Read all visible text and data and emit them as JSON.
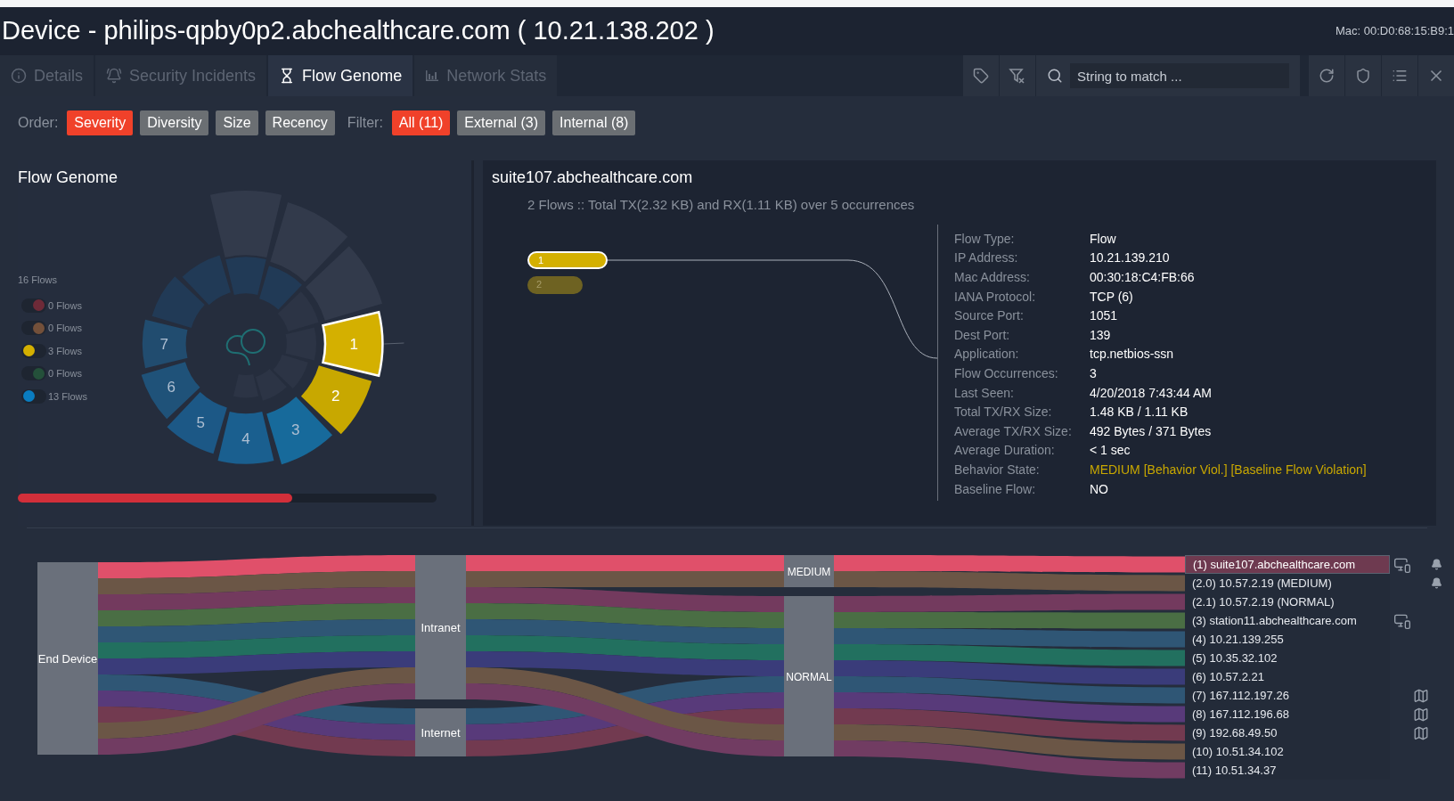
{
  "window": {
    "title": "Device - philips-qpby0p2.abchealthcare.com ( 10.21.138.202 )",
    "mac": "Mac: 00:D0:68:15:B9:1"
  },
  "tabs": [
    {
      "label": "Details",
      "selected": false
    },
    {
      "label": "Security Incidents",
      "selected": false
    },
    {
      "label": "Flow Genome",
      "selected": true
    },
    {
      "label": "Network Stats",
      "selected": false
    }
  ],
  "search": {
    "placeholder": "String to match ..."
  },
  "order": {
    "label": "Order:",
    "options": [
      {
        "label": "Severity",
        "selected": true
      },
      {
        "label": "Diversity",
        "selected": false
      },
      {
        "label": "Size",
        "selected": false
      },
      {
        "label": "Recency",
        "selected": false
      }
    ]
  },
  "filter": {
    "label": "Filter:",
    "options": [
      {
        "label": "All (11)",
        "selected": true
      },
      {
        "label": "External (3)",
        "selected": false
      },
      {
        "label": "Internal (8)",
        "selected": false
      }
    ]
  },
  "genome": {
    "title": "Flow Genome",
    "total": "16 Flows",
    "legend": [
      {
        "label": "0 Flows",
        "color": "#6e2a38",
        "muted": true
      },
      {
        "label": "0 Flows",
        "color": "#73503a",
        "muted": true
      },
      {
        "label": "3 Flows",
        "color": "#d4b000",
        "muted": false
      },
      {
        "label": "0 Flows",
        "color": "#24503a",
        "muted": true
      },
      {
        "label": "13 Flows",
        "color": "#0a7cc0",
        "muted": false
      }
    ],
    "segments": [
      {
        "label": "1",
        "color": "#d4b000",
        "selected": true
      },
      {
        "label": "2",
        "color": "#c8a800",
        "selected": false
      },
      {
        "label": "3",
        "color": "#176a9b",
        "selected": false
      },
      {
        "label": "4",
        "color": "#1a5f8f",
        "selected": false
      },
      {
        "label": "5",
        "color": "#1c5886",
        "selected": false
      },
      {
        "label": "6",
        "color": "#1f5279",
        "selected": false
      },
      {
        "label": "7",
        "color": "#214c6f",
        "selected": false
      }
    ],
    "progress": {
      "level": 0.655
    }
  },
  "details": {
    "title": "suite107.abchealthcare.com",
    "summary": "2 Flows :: Total TX(2.32 KB) and RX(1.11 KB) over 5 occurrences",
    "flows": [
      {
        "label": "1",
        "selected": true
      },
      {
        "label": "2",
        "selected": false
      }
    ],
    "fields": [
      {
        "label": "Flow Type:",
        "value": "Flow",
        "alert": false
      },
      {
        "label": "IP Address:",
        "value": "10.21.139.210",
        "alert": false
      },
      {
        "label": "Mac Address:",
        "value": "00:30:18:C4:FB:66",
        "alert": false
      },
      {
        "label": "IANA Protocol:",
        "value": "TCP (6)",
        "alert": false
      },
      {
        "label": "Source Port:",
        "value": "1051",
        "alert": false
      },
      {
        "label": "Dest Port:",
        "value": "139",
        "alert": false
      },
      {
        "label": "Application:",
        "value": "tcp.netbios-ssn",
        "alert": false
      },
      {
        "label": "Flow Occurrences:",
        "value": "3",
        "alert": false
      },
      {
        "label": "Last Seen:",
        "value": "4/20/2018 7:43:44 AM",
        "alert": false
      },
      {
        "label": "Total TX/RX Size:",
        "value": "1.48 KB / 1.11 KB",
        "alert": false
      },
      {
        "label": "Average TX/RX Size:",
        "value": "492 Bytes / 371 Bytes",
        "alert": false
      },
      {
        "label": "Average Duration:",
        "value": "< 1 sec",
        "alert": false
      },
      {
        "label": "Behavior State:",
        "value": "MEDIUM [Behavior Viol.] [Baseline Flow Violation]",
        "alert": true
      },
      {
        "label": "Baseline Flow:",
        "value": "NO",
        "alert": false
      }
    ]
  },
  "sankey": {
    "source": "End Device",
    "networks": [
      "Intranet",
      "Internet"
    ],
    "states": [
      "MEDIUM",
      "NORMAL"
    ],
    "destinations": [
      {
        "label": "(1) suite107.abchealthcare.com",
        "color": "#e0506a",
        "selected": true,
        "device": true,
        "incident": true,
        "geolocated": false
      },
      {
        "label": "(2.0) 10.57.2.19 (MEDIUM)",
        "color": "#6b5646",
        "selected": false,
        "device": false,
        "incident": true,
        "geolocated": false
      },
      {
        "label": "(2.1) 10.57.2.19 (NORMAL)",
        "color": "#733a5e",
        "selected": false,
        "device": false,
        "incident": false,
        "geolocated": false
      },
      {
        "label": "(3) station11.abchealthcare.com",
        "color": "#4a6e44",
        "selected": false,
        "device": true,
        "incident": false,
        "geolocated": false
      },
      {
        "label": "(4) 10.21.139.255",
        "color": "#2f5675",
        "selected": false,
        "device": false,
        "incident": false,
        "geolocated": false
      },
      {
        "label": "(5) 10.35.32.102",
        "color": "#22705f",
        "selected": false,
        "device": false,
        "incident": false,
        "geolocated": false
      },
      {
        "label": "(6) 10.57.2.21",
        "color": "#3a3c7a",
        "selected": false,
        "device": false,
        "incident": false,
        "geolocated": false
      },
      {
        "label": "(7) 167.112.197.26",
        "color": "#2f5675",
        "selected": false,
        "device": false,
        "incident": false,
        "geolocated": true
      },
      {
        "label": "(8) 167.112.196.68",
        "color": "#583a7a",
        "selected": false,
        "device": false,
        "incident": false,
        "geolocated": true
      },
      {
        "label": "(9) 192.68.49.50",
        "color": "#723a50",
        "selected": false,
        "device": false,
        "incident": false,
        "geolocated": true
      },
      {
        "label": "(10) 10.51.34.102",
        "color": "#6b5646",
        "selected": false,
        "device": false,
        "incident": false,
        "geolocated": false
      },
      {
        "label": "(11) 10.51.34.37",
        "color": "#713c62",
        "selected": false,
        "device": false,
        "incident": false,
        "geolocated": false
      }
    ]
  }
}
